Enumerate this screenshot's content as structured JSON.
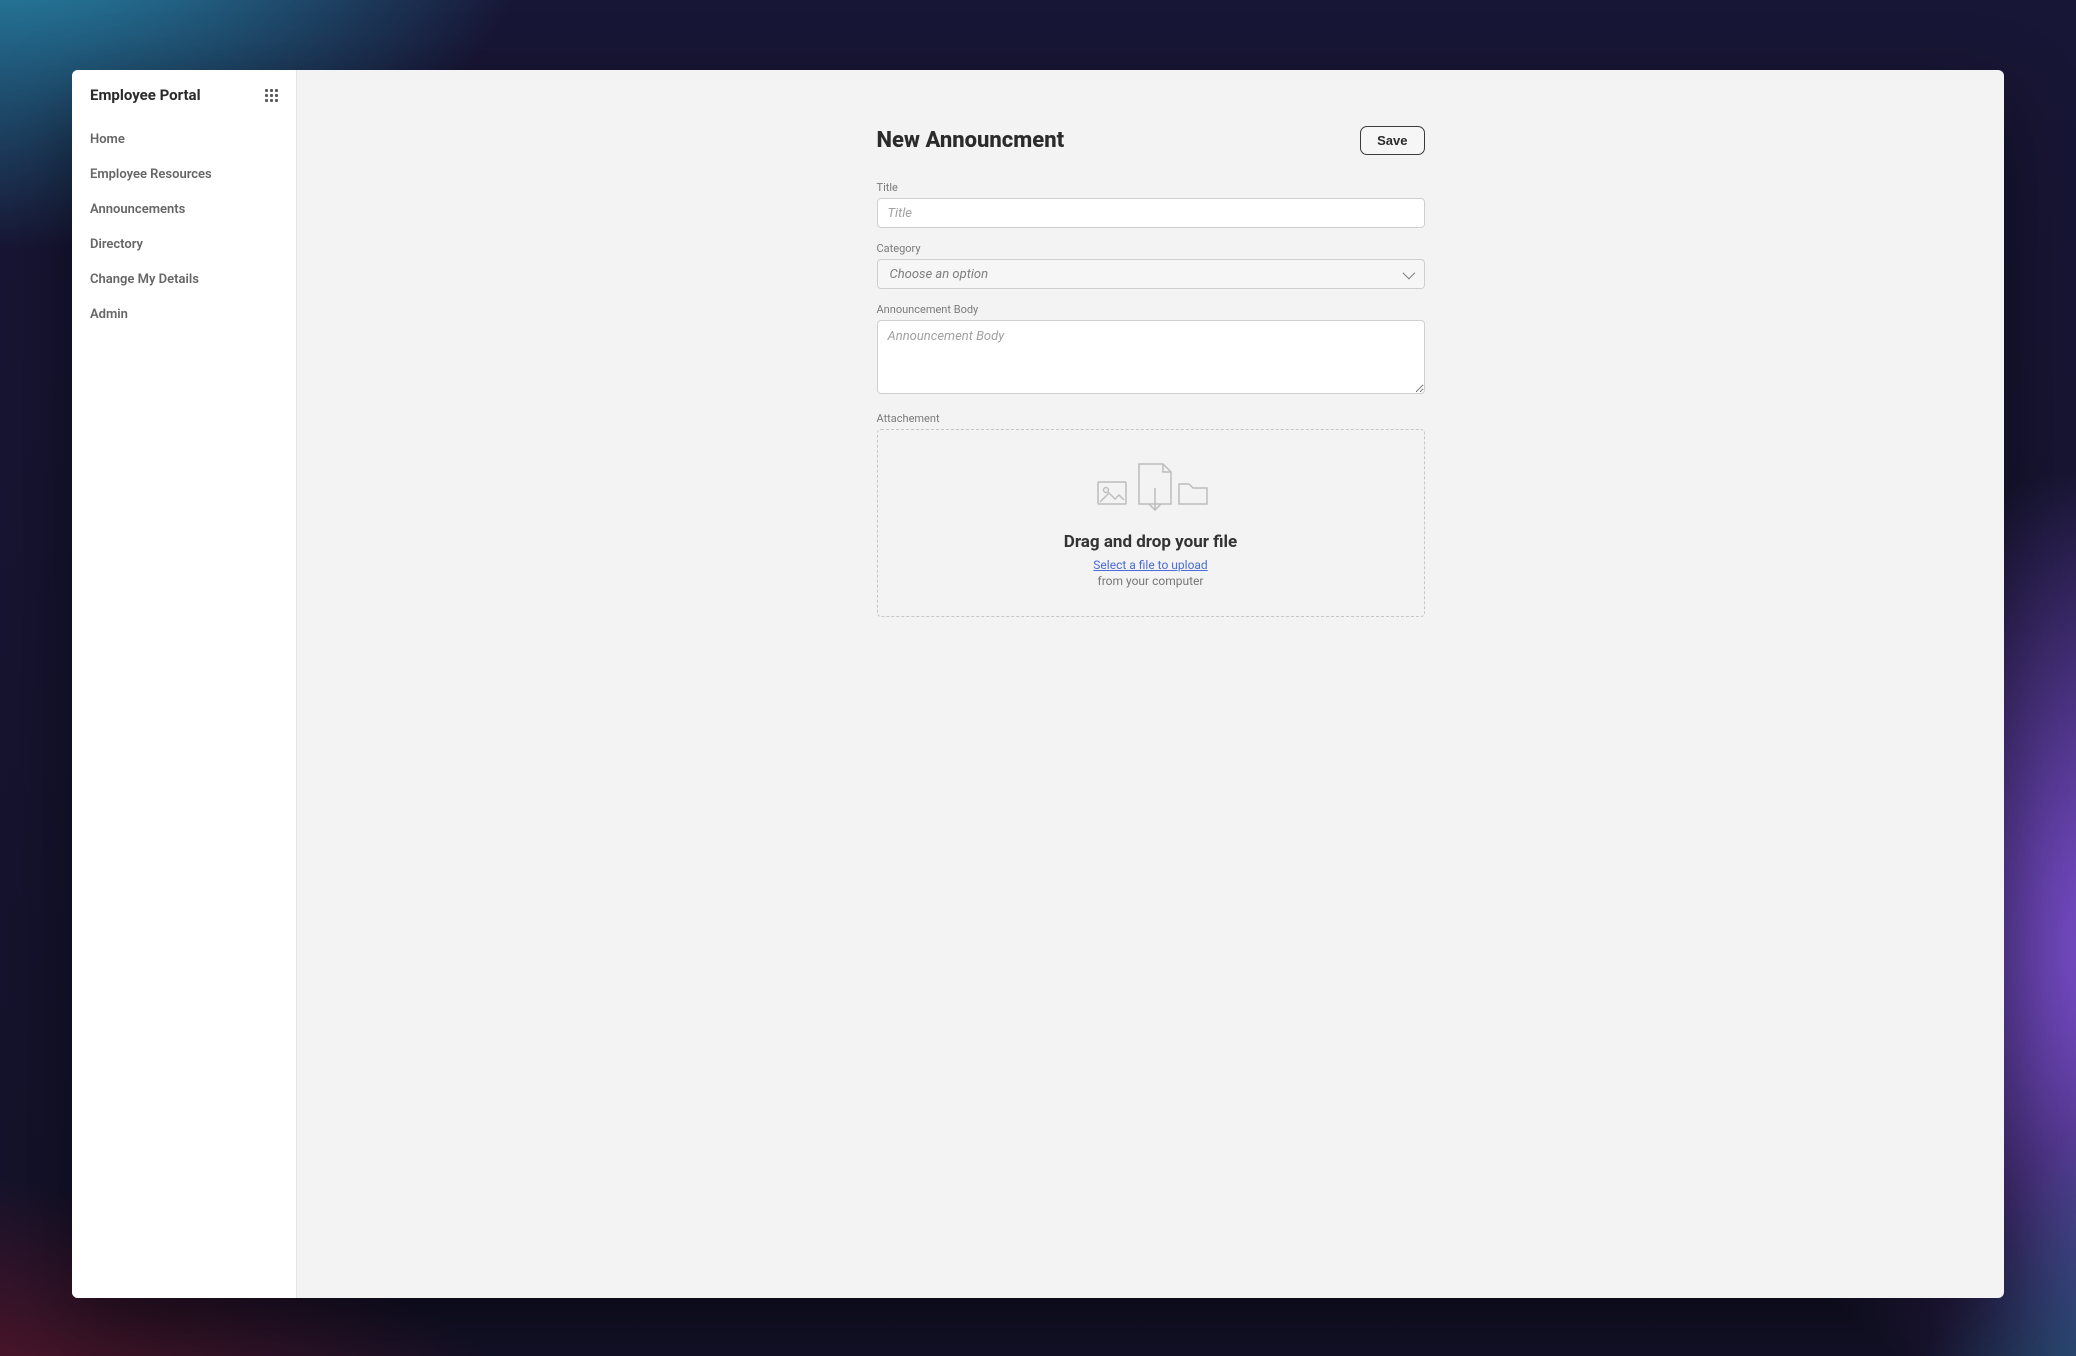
{
  "sidebar": {
    "title": "Employee Portal",
    "items": [
      {
        "label": "Home"
      },
      {
        "label": "Employee Resources"
      },
      {
        "label": "Announcements"
      },
      {
        "label": "Directory"
      },
      {
        "label": "Change My Details"
      },
      {
        "label": "Admin"
      }
    ]
  },
  "page": {
    "title": "New Announcment",
    "save_label": "Save"
  },
  "form": {
    "title": {
      "label": "Title",
      "placeholder": "Title",
      "value": ""
    },
    "category": {
      "label": "Category",
      "placeholder": "Choose an option",
      "value": ""
    },
    "body": {
      "label": "Announcement Body",
      "placeholder": "Announcement Body",
      "value": ""
    },
    "attachment": {
      "label": "Attachement",
      "drop_title": "Drag and drop your file",
      "link_text": "Select a file to upload",
      "sub_text": "from your computer"
    }
  }
}
